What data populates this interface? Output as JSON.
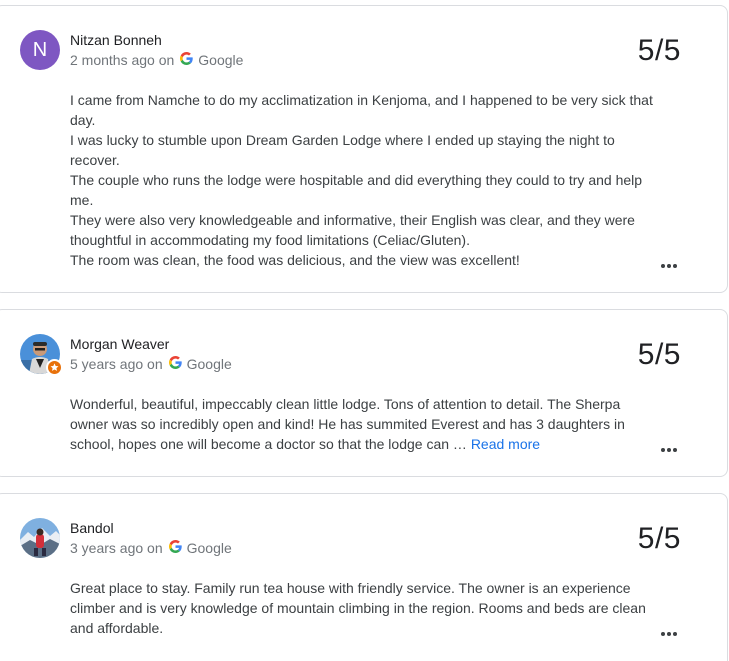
{
  "source_label": "Google",
  "colors": {
    "avatar_n": "#7e57c2",
    "link": "#1a73e8",
    "badge": "#e8710a"
  },
  "reviews": [
    {
      "reviewer": "Nitzan Bonneh",
      "avatar_letter": "N",
      "time": "2 months ago on",
      "source": "Google",
      "rating": "5/5",
      "paragraphs": [
        "I came from Namche to do my acclimatization in Kenjoma, and I happened to be very sick that day.",
        "I was lucky to stumble upon Dream Garden Lodge where I ended up staying the night to recover.",
        "The couple who runs the lodge were hospitable and did everything they could to try and help me.",
        "They were also very knowledgeable and informative, their English was clear, and they were thoughtful in accommodating my food limitations (Celiac/Gluten).",
        "The room was clean, the food was delicious, and the view was excellent!"
      ],
      "more_icon": "more-horiz-icon"
    },
    {
      "reviewer": "Morgan Weaver",
      "avatar_icon": "profile-photo",
      "badge_icon": "local-guide-star-icon",
      "time": "5 years ago on",
      "source": "Google",
      "rating": "5/5",
      "text": "Wonderful, beautiful, impeccably clean little lodge. Tons of attention to detail. The Sherpa owner was so incredibly open and kind! He has summited Everest and has 3 daughters in school, hopes one will become a doctor so that the lodge can …",
      "read_more": "Read more",
      "more_icon": "more-horiz-icon"
    },
    {
      "reviewer": "Bandol",
      "avatar_icon": "profile-photo",
      "time": "3 years ago on",
      "source": "Google",
      "rating": "5/5",
      "text": "Great place to stay. Family run tea house with friendly service. The owner is an experience climber and is very knowledge of mountain climbing in the region. Rooms and beds are clean and affordable.",
      "more_icon": "more-horiz-icon"
    }
  ]
}
